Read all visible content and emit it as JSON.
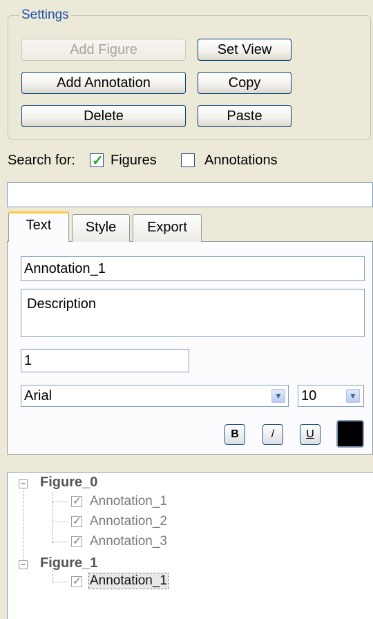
{
  "settings": {
    "legend": "Settings",
    "add_figure": "Add Figure",
    "set_view": "Set View",
    "add_annotation": "Add Annotation",
    "copy": "Copy",
    "delete": "Delete",
    "paste": "Paste"
  },
  "search": {
    "label": "Search for:",
    "figures_label": "Figures",
    "figures_checked": true,
    "annotations_label": "Annotations",
    "annotations_checked": false,
    "value": ""
  },
  "tabs": [
    {
      "label": "Text",
      "active": true
    },
    {
      "label": "Style",
      "active": false
    },
    {
      "label": "Export",
      "active": false
    }
  ],
  "text_tab": {
    "name_value": "Annotation_1",
    "description_value": "Description",
    "number_value": "1",
    "font_value": "Arial",
    "size_value": "10",
    "bold_label": "B",
    "italic_label": "/",
    "underline_label": "U",
    "color": "#000000"
  },
  "tree": {
    "figures": [
      {
        "label": "Figure_0",
        "children": [
          "Annotation_1",
          "Annotation_2",
          "Annotation_3"
        ]
      },
      {
        "label": "Figure_1",
        "children": [
          "Annotation_1"
        ]
      }
    ],
    "selected": "Figure_1/Annotation_1"
  }
}
